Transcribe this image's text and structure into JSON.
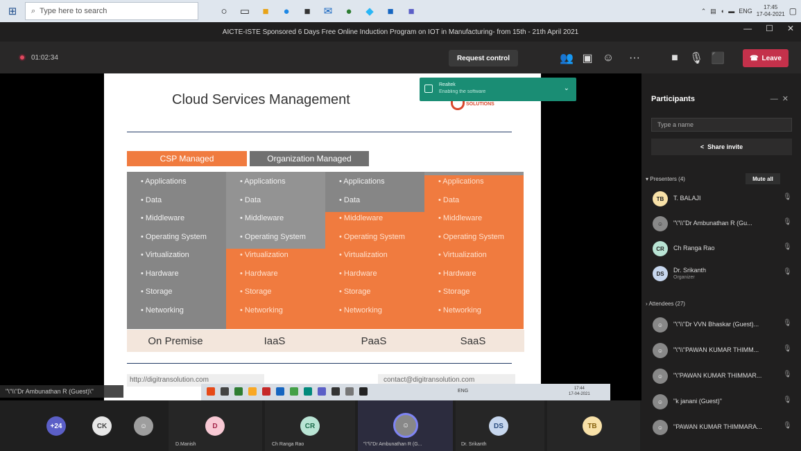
{
  "taskbar": {
    "search_placeholder": "Type here to search",
    "tray_lang": "ENG",
    "clock_time": "17:45",
    "clock_date": "17-04-2021"
  },
  "window": {
    "title": "AICTE-ISTE Sponsored 6 Days Free Online Induction Program on IOT in Manufacturing- from 15th - 21th April 2021",
    "minimize": "—",
    "maximize": "☐",
    "close": "✕"
  },
  "meeting": {
    "timer": "01:02:34",
    "request_control": "Request control",
    "leave": "Leave"
  },
  "slide": {
    "title": "Cloud Services Management",
    "brand": "SOLUTIONS",
    "csp_label": "CSP Managed",
    "org_label": "Organization Managed",
    "items": [
      "Applications",
      "Data",
      "Middleware",
      "Operating System",
      "Virtualization",
      "Hardware",
      "Storage",
      "Networking"
    ],
    "columns": [
      "On Premise",
      "IaaS",
      "PaaS",
      "SaaS"
    ],
    "url_left": "http://digitransolution.com",
    "url_right": "contact@digitransolution.com"
  },
  "toast": {
    "line1": "Realtek",
    "line2": "Enabling the software"
  },
  "inner_taskbar": {
    "tray": "ENG",
    "time": "17:44",
    "date": "17-04-2021"
  },
  "presenter_tag": "\"\\\"\\\\\"Dr Ambunathan R (Guest)\\\"",
  "panel": {
    "title": "Participants",
    "search_placeholder": "Type a name",
    "share_invite": "Share invite",
    "presenters_heading": "Presenters (4)",
    "mute_all": "Mute all",
    "attendees_heading": "Attendees (27)",
    "presenters": [
      {
        "initials": "TB",
        "name": "T. BALAJI",
        "role": ""
      },
      {
        "initials": "",
        "name": "\"\\\"\\\\\"Dr Ambunathan R (Gu...",
        "role": ""
      },
      {
        "initials": "CR",
        "name": "Ch Ranga Rao",
        "role": ""
      },
      {
        "initials": "DS",
        "name": "Dr. Srikanth",
        "role": "Organizer"
      }
    ],
    "attendees": [
      {
        "name": "\"\\\"\\\\\"Dr VVN Bhaskar (Guest)..."
      },
      {
        "name": "\"\\\"\\\\\"PAWAN KUMAR THIMM..."
      },
      {
        "name": "\"\\\"PAWAN KUMAR THIMMAR..."
      },
      {
        "name": "\"k janani (Guest)\""
      },
      {
        "name": "\"PAWAN KUMAR THIMMARA..."
      }
    ]
  },
  "strip": {
    "more_count": "+24",
    "ck": "CK",
    "d_initial": "D",
    "d_name": "D.Manish",
    "cr_initial": "CR",
    "cr_name": "Ch Ranga Rao",
    "amb_name": "\"\\\"\\\\\"Dr Ambunathan R (G...",
    "ds_initial": "DS",
    "ds_name": "Dr. Srikanth",
    "tb_initial": "TB"
  },
  "colors": {
    "accent_orange": "#f07b3f",
    "leave_red": "#c4314b",
    "toast_green": "#1a8d74"
  }
}
